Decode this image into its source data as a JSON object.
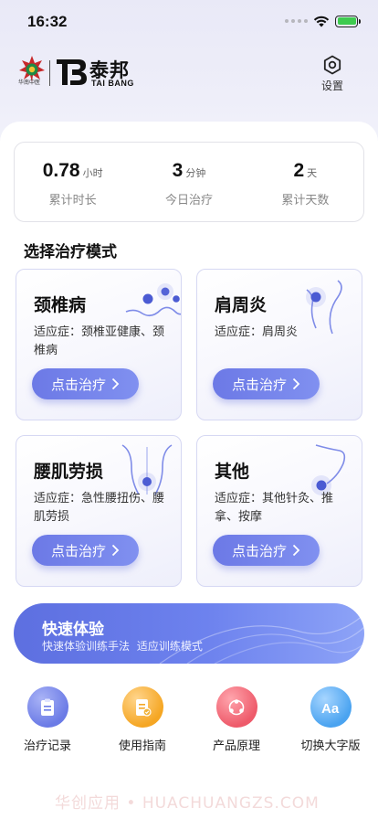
{
  "status_bar": {
    "time": "16:32"
  },
  "brand": {
    "emblem_caption": "华南中医",
    "name_cn": "泰邦",
    "name_en": "TAI BANG"
  },
  "settings": {
    "label": "设置",
    "icon": "gear-icon"
  },
  "stats": [
    {
      "value": "0.78",
      "unit": "小时",
      "label": "累计时长"
    },
    {
      "value": "3",
      "unit": "分钟",
      "label": "今日治疗"
    },
    {
      "value": "2",
      "unit": "天",
      "label": "累计天数"
    }
  ],
  "section_title": "选择治疗模式",
  "modes": [
    {
      "title": "颈椎病",
      "desc": "适应症：颈椎亚健康、颈椎病",
      "button": "点击治疗"
    },
    {
      "title": "肩周炎",
      "desc": "适应症：肩周炎",
      "button": "点击治疗"
    },
    {
      "title": "腰肌劳损",
      "desc": "适应症：急性腰扭伤、腰肌劳损",
      "button": "点击治疗"
    },
    {
      "title": "其他",
      "desc": "适应症：其他针灸、推拿、按摩",
      "button": "点击治疗"
    }
  ],
  "quick": {
    "title": "快速体验",
    "subtitle": "快速体验训练手法 适应训练模式"
  },
  "nav": [
    {
      "label": "治疗记录",
      "icon": "clipboard-icon",
      "color": "#6b7be6"
    },
    {
      "label": "使用指南",
      "icon": "guide-book-icon",
      "color": "#f5a623"
    },
    {
      "label": "产品原理",
      "icon": "molecule-icon",
      "color": "#ee5a6a"
    },
    {
      "label": "切换大字版",
      "icon": "font-size-icon",
      "color": "#4aa3f0"
    }
  ],
  "watermark": "华创应用 • HUACHUANGZS.COM"
}
